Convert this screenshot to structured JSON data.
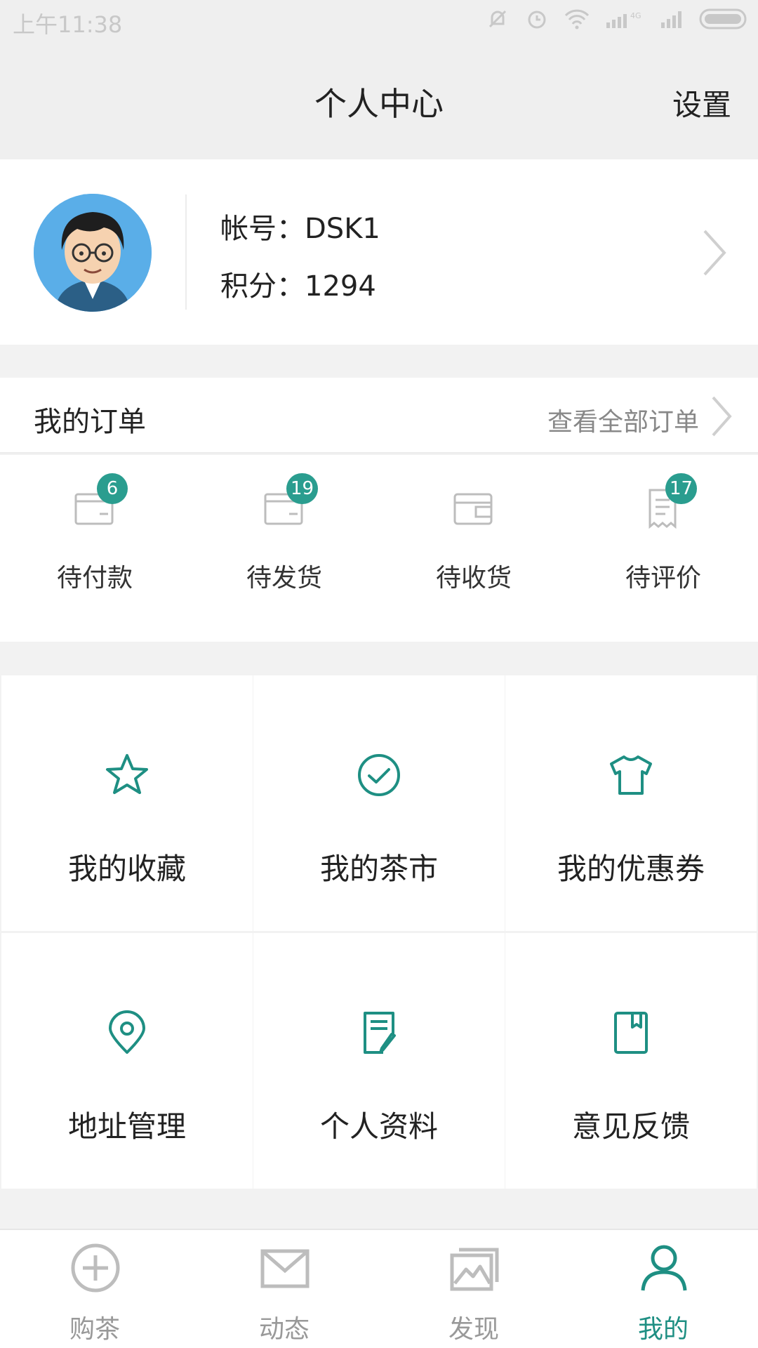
{
  "status_bar": {
    "time": "上午11:38"
  },
  "header": {
    "title": "个人中心",
    "settings_label": "设置"
  },
  "profile": {
    "account": "帐号：DSK1",
    "points": "积分：1294"
  },
  "orders": {
    "title": "我的订单",
    "view_all": "查看全部订单",
    "items": [
      {
        "label": "待付款",
        "badge": "6",
        "icon": "wallet-icon"
      },
      {
        "label": "待发货",
        "badge": "19",
        "icon": "card-icon"
      },
      {
        "label": "待收货",
        "badge": "",
        "icon": "box-icon"
      },
      {
        "label": "待评价",
        "badge": "17",
        "icon": "receipt-icon"
      }
    ]
  },
  "features": [
    {
      "label": "我的收藏",
      "icon": "star-icon"
    },
    {
      "label": "我的茶市",
      "icon": "check-circle-icon"
    },
    {
      "label": "我的优惠券",
      "icon": "tshirt-icon"
    },
    {
      "label": "地址管理",
      "icon": "location-icon"
    },
    {
      "label": "个人资料",
      "icon": "edit-doc-icon"
    },
    {
      "label": "意见反馈",
      "icon": "feedback-icon"
    }
  ],
  "tabs": [
    {
      "label": "购茶",
      "icon": "plus-circle-icon",
      "active": false
    },
    {
      "label": "动态",
      "icon": "mail-icon",
      "active": false
    },
    {
      "label": "发现",
      "icon": "gallery-icon",
      "active": false
    },
    {
      "label": "我的",
      "icon": "user-icon",
      "active": true
    }
  ],
  "colors": {
    "accent": "#1e8f83",
    "badge": "#2a9d8f",
    "inactive": "#999999"
  }
}
